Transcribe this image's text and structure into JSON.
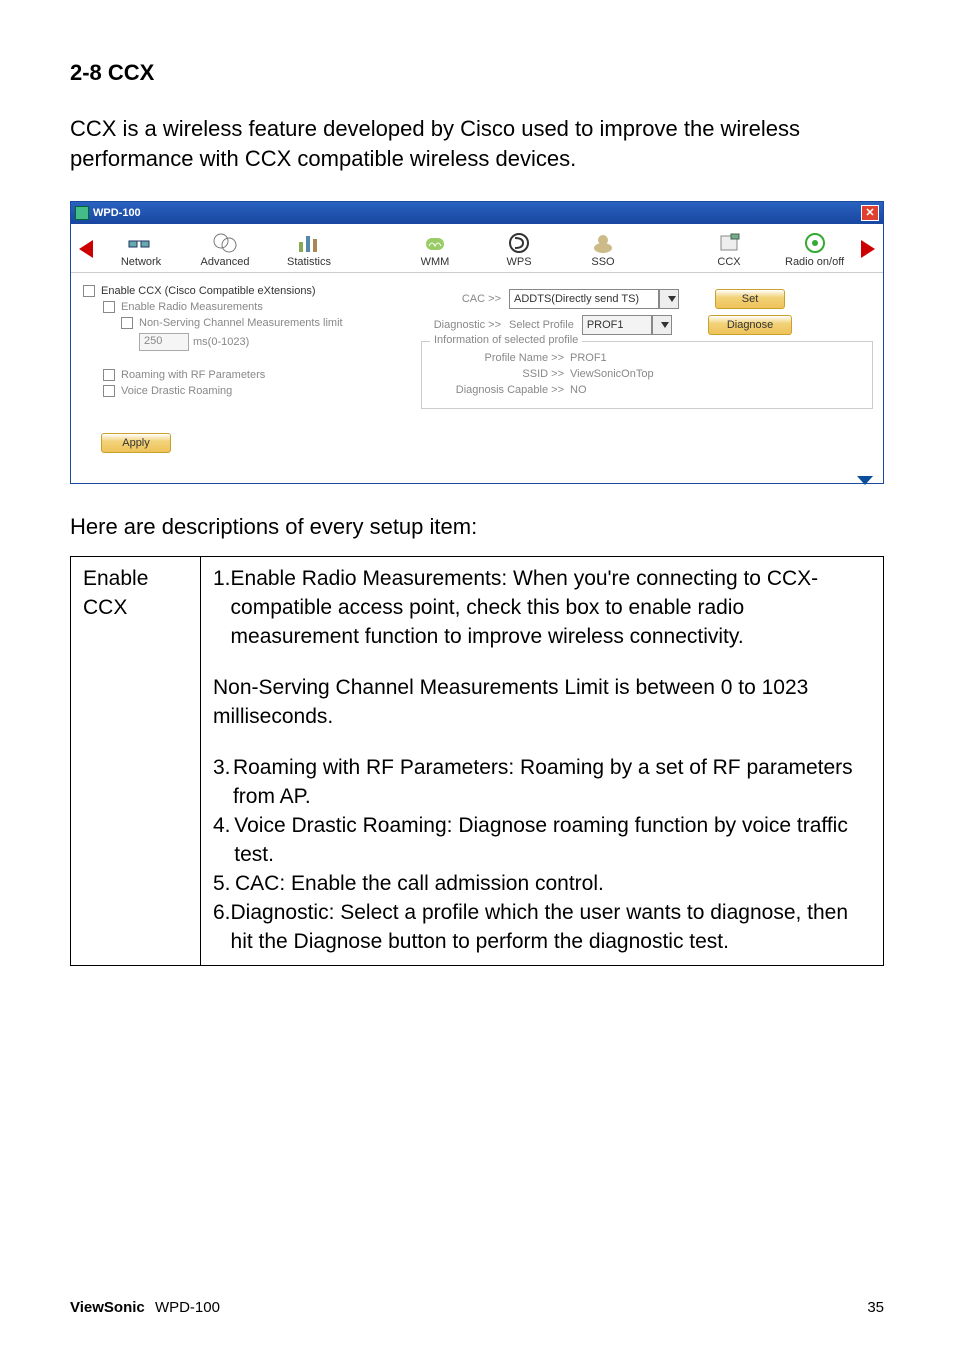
{
  "heading": "2-8 CCX",
  "intro": "CCX is a wireless feature developed by Cisco used to improve the wireless performance with CCX compatible wireless devices.",
  "window": {
    "title": "WPD-100",
    "nav": {
      "items": [
        {
          "label": "Network",
          "icon": "network"
        },
        {
          "label": "Advanced",
          "icon": "advanced"
        },
        {
          "label": "Statistics",
          "icon": "statistics"
        },
        {
          "label": "WMM",
          "icon": "wmm"
        },
        {
          "label": "WPS",
          "icon": "wps"
        },
        {
          "label": "SSO",
          "icon": "sso"
        },
        {
          "label": "CCX",
          "icon": "ccx"
        },
        {
          "label": "Radio on/off",
          "icon": "radio"
        }
      ]
    },
    "panel": {
      "enable_ccx": "Enable CCX (Cisco Compatible eXtensions)",
      "enable_radio": "Enable Radio Measurements",
      "non_serving": "Non-Serving Channel Measurements limit",
      "ms_value": "250",
      "ms_range": "ms(0-1023)",
      "roaming_rf": "Roaming with RF Parameters",
      "voice_drastic": "Voice Drastic Roaming",
      "cac_label": "CAC >>",
      "cac_value": "ADDTS(Directly send TS)",
      "set_btn": "Set",
      "diagnostic_label": "Diagnostic >>",
      "select_profile_label": "Select Profile",
      "select_profile_value": "PROF1",
      "diagnose_btn": "Diagnose",
      "info_legend": "Information of selected profile",
      "profile_name_l": "Profile Name >>",
      "profile_name_v": "PROF1",
      "ssid_l": "SSID >>",
      "ssid_v": "ViewSonicOnTop",
      "diag_cap_l": "Diagnosis Capable >>",
      "diag_cap_v": "NO",
      "apply_btn": "Apply"
    }
  },
  "desc_intro": "Here are descriptions of every setup item:",
  "table": {
    "c1_l1": "Enable",
    "c1_l2": "CCX",
    "c2_p1_num": "1.",
    "c2_p1": "Enable Radio Measurements: When you're connecting to CCX-compatible access point, check this box to enable radio measurement function to improve wireless connectivity.",
    "c2_p2": "Non-Serving Channel Measurements Limit is between 0 to 1023 milliseconds.",
    "c2_p3_num": "3.",
    "c2_p3": "Roaming with RF Parameters: Roaming by a set of RF parameters from AP.",
    "c2_p4_num": "4.",
    "c2_p4": "Voice Drastic Roaming: Diagnose roaming function by voice traffic test.",
    "c2_p5_num": "5.",
    "c2_p5": "CAC: Enable the call admission control.",
    "c2_p6_num": "6.",
    "c2_p6": "Diagnostic: Select a profile which the user wants to diagnose, then hit the Diagnose button to perform the diagnostic test."
  },
  "footer": {
    "brand": "ViewSonic",
    "model": "WPD-100",
    "page": "35"
  }
}
